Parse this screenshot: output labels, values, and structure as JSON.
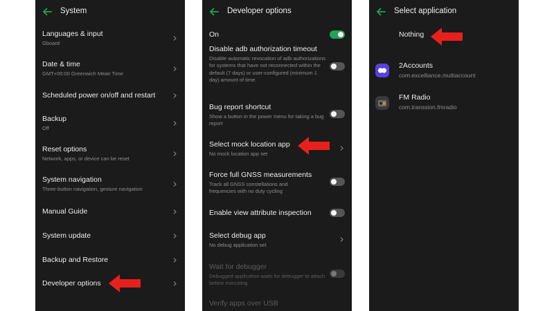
{
  "colors": {
    "panel_bg": "#1b1b1b",
    "accent": "#1fa35a",
    "arrow": "#e8201c",
    "subtext": "#8e8e8e"
  },
  "panel1": {
    "title": "System",
    "back_icon": "back-arrow-icon",
    "items": [
      {
        "title": "Languages & input",
        "subtitle": "Gboard"
      },
      {
        "title": "Date & time",
        "subtitle": "GMT+00:00 Greenwich Mean Time"
      },
      {
        "title": "Scheduled power on/off and restart",
        "subtitle": ""
      },
      {
        "title": "Backup",
        "subtitle": "Off"
      },
      {
        "title": "Reset options",
        "subtitle": "Network, apps, or device can be reset"
      },
      {
        "title": "System navigation",
        "subtitle": "Three-button navigation, gesture navigation"
      },
      {
        "title": "Manual Guide",
        "subtitle": ""
      },
      {
        "title": "System update",
        "subtitle": ""
      },
      {
        "title": "Backup and Restore",
        "subtitle": ""
      },
      {
        "title": "Developer options",
        "subtitle": ""
      }
    ]
  },
  "panel2": {
    "title": "Developer options",
    "on_label": "On",
    "on_state": true,
    "items": [
      {
        "title": "Disable adb authorization timeout",
        "subtitle": "Disable automatic revocation of adb authorizations for systems that have not reconnected within the default (7 days) or user-configured (minimum 1 day) amount of time.",
        "control": "toggle",
        "state": false
      },
      {
        "title": "Bug report shortcut",
        "subtitle": "Show a button in the power menu for taking a bug report",
        "control": "toggle",
        "state": false
      },
      {
        "title": "Select mock location app",
        "subtitle": "No mock location app set",
        "control": "chevron"
      },
      {
        "title": "Force full GNSS measurements",
        "subtitle": "Track all GNSS constellations and frequencies with no duty cycling",
        "control": "toggle",
        "state": false
      },
      {
        "title": "Enable view attribute inspection",
        "subtitle": "",
        "control": "toggle",
        "state": false
      },
      {
        "title": "Select debug app",
        "subtitle": "No debug application set",
        "control": "chevron"
      },
      {
        "title": "Wait for debugger",
        "subtitle": "Debugged application waits for debugger to attach before executing",
        "control": "toggle",
        "state": false,
        "disabled": true
      },
      {
        "title": "Verify apps over USB",
        "subtitle": "",
        "control": "none"
      }
    ]
  },
  "panel3": {
    "title": "Select application",
    "nothing_label": "Nothing",
    "apps": [
      {
        "name": "2Accounts",
        "package": "com.excelliance.multiaccount",
        "icon": "two-accounts-app-icon"
      },
      {
        "name": "FM Radio",
        "package": "com.transsion.fmradio",
        "icon": "fm-radio-app-icon"
      }
    ]
  }
}
